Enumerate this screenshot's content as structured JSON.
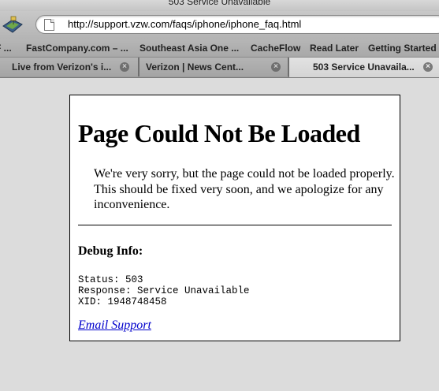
{
  "window": {
    "title": "503 Service Unavailable"
  },
  "toolbar": {
    "url": "http://support.vzw.com/faqs/iphone/iphone_faq.html"
  },
  "bookmarks": [
    "F ...",
    "FastCompany.com – ...",
    "Southeast Asia One ...",
    "CacheFlow",
    "Read Later",
    "Getting Started"
  ],
  "tabs": [
    {
      "label": "Live from Verizon's i...",
      "active": false
    },
    {
      "label": "Verizon | News Cent...",
      "active": false
    },
    {
      "label": "503 Service Unavaila...",
      "active": true
    }
  ],
  "error_page": {
    "heading": "Page Could Not Be Loaded",
    "message": "We're very sorry, but the page could not be loaded properly. This should be fixed very soon, and we apologize for any inconvenience.",
    "debug_heading": "Debug Info:",
    "debug_lines": [
      "Status: 503",
      "Response: Service Unavailable",
      "XID: 1948748458"
    ],
    "support_link": "Email Support"
  }
}
